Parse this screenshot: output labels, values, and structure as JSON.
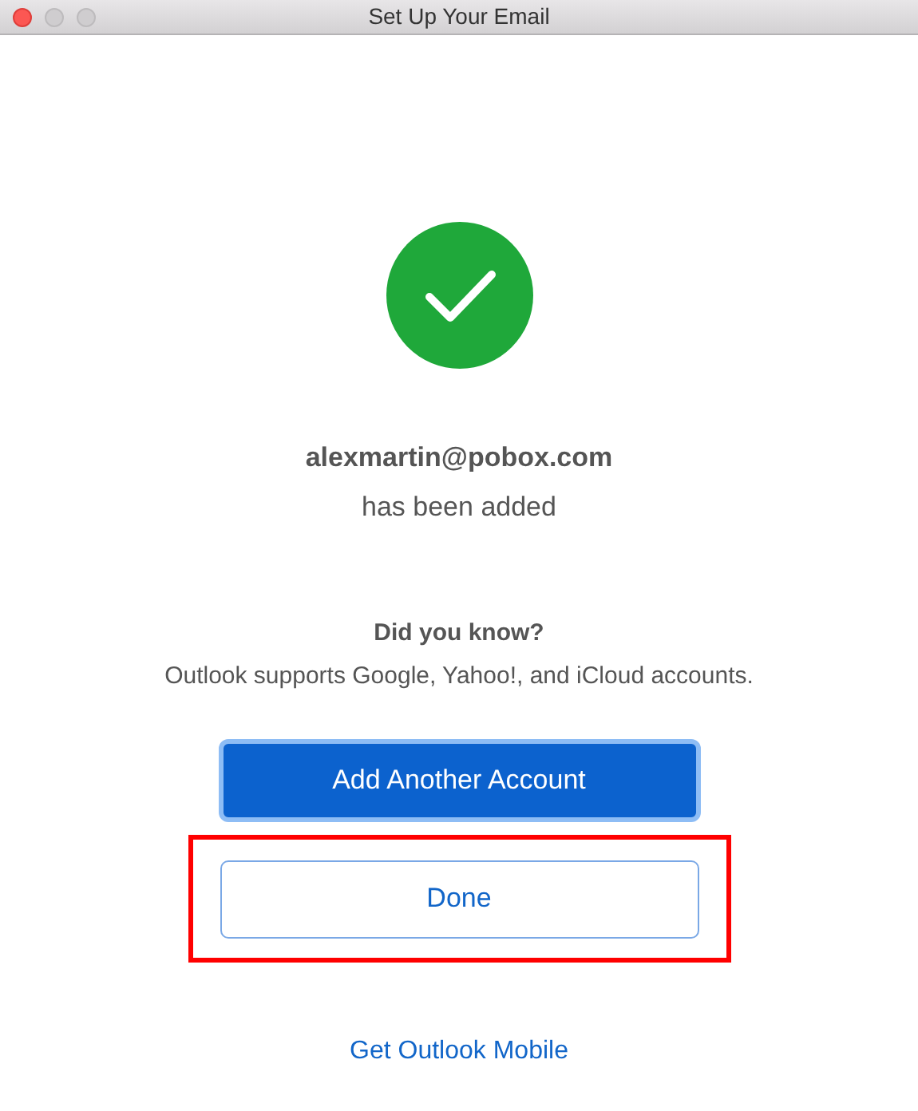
{
  "window": {
    "title": "Set Up Your Email",
    "controls": [
      {
        "kind": "close",
        "disabled": false
      },
      {
        "kind": "minimize",
        "disabled": true
      },
      {
        "kind": "zoom",
        "disabled": true
      }
    ]
  },
  "account": {
    "email": "alexmartin@pobox.com",
    "status": "has been added"
  },
  "tip": {
    "heading": "Did you know?",
    "text": "Outlook supports Google, Yahoo!, and iCloud accounts."
  },
  "buttons": [
    {
      "label": "Add Another Account",
      "kind": "primary",
      "highlighted": false
    },
    {
      "label": "Done",
      "kind": "secondary",
      "highlighted": true
    }
  ],
  "link": "Get Outlook Mobile"
}
